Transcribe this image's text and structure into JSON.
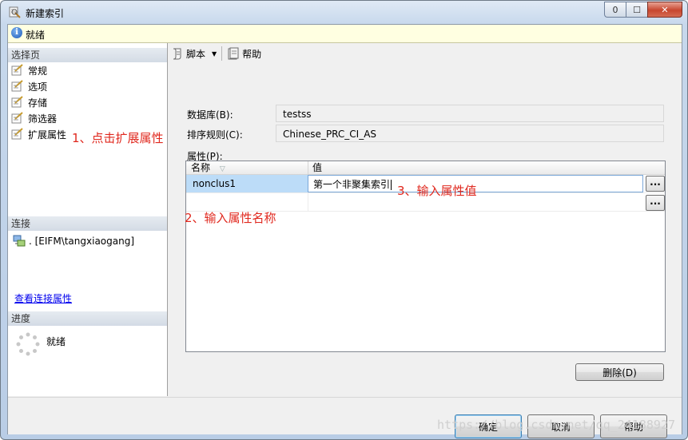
{
  "window": {
    "title": "新建索引",
    "icon": "index-icon",
    "min_glyph": "0",
    "max_glyph": "1",
    "close_glyph": "x"
  },
  "status": {
    "text": "就绪",
    "icon": "info-icon"
  },
  "left": {
    "select_page_header": "选择页",
    "pages": [
      {
        "label": "常规",
        "icon": "page-icon"
      },
      {
        "label": "选项",
        "icon": "page-icon"
      },
      {
        "label": "存储",
        "icon": "page-icon"
      },
      {
        "label": "筛选器",
        "icon": "page-icon"
      },
      {
        "label": "扩展属性",
        "icon": "page-icon"
      }
    ],
    "connection_header": "连接",
    "connection_text": ". [EIFM\\tangxiaogang]",
    "connection_link": "查看连接属性",
    "progress_header": "进度",
    "progress_text": "就绪"
  },
  "toolbar": {
    "script_label": "脚本",
    "help_label": "帮助"
  },
  "form": {
    "database_label": "数据库(B):",
    "database_value": "testss",
    "collation_label": "排序规则(C):",
    "collation_value": "Chinese_PRC_CI_AS",
    "properties_label": "属性(P):"
  },
  "grid": {
    "col_name": "名称",
    "col_value": "值",
    "rows": [
      {
        "name": "nonclus1",
        "value": "第一个非聚集索引"
      },
      {
        "name": "",
        "value": ""
      }
    ],
    "ellipsis": "..."
  },
  "buttons": {
    "delete": "删除(D)",
    "ok": "确定",
    "cancel": "取消",
    "help": "帮助"
  },
  "annotations": {
    "step1": "1、点击扩展属性",
    "step2": "2、输入属性名称",
    "step3": "3、输入属性值",
    "color": "#e0281e"
  },
  "watermark": "https://blog.csdn.net/qq_24188927"
}
